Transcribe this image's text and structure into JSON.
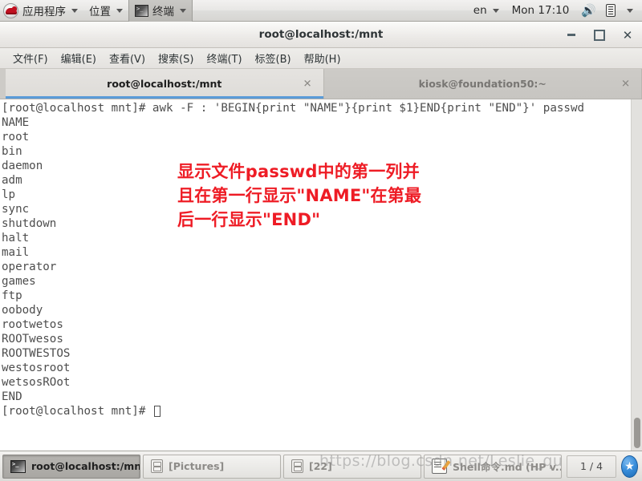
{
  "top_panel": {
    "logo_icon": "redhat-logo-icon",
    "applications_label": "应用程序",
    "places_label": "位置",
    "terminal_label": "终端",
    "terminal_icon": "terminal-icon",
    "keyboard_layout": "en",
    "clock": "Mon 17:10",
    "volume_icon": "speaker-icon",
    "battery_icon": "document-battery-icon",
    "system_caret_icon": "chevron-down-icon"
  },
  "window": {
    "title": "root@localhost:/mnt",
    "minimize_icon": "minimize-icon",
    "maximize_icon": "maximize-icon",
    "close_icon": "close-icon"
  },
  "menubar": {
    "items": [
      {
        "label": "文件(F)"
      },
      {
        "label": "编辑(E)"
      },
      {
        "label": "查看(V)"
      },
      {
        "label": "搜索(S)"
      },
      {
        "label": "终端(T)"
      },
      {
        "label": "标签(B)"
      },
      {
        "label": "帮助(H)"
      }
    ]
  },
  "tabs": [
    {
      "label": "root@localhost:/mnt",
      "close_icon": "close-icon",
      "active": true
    },
    {
      "label": "kiosk@foundation50:~",
      "close_icon": "close-icon",
      "active": false
    }
  ],
  "terminal": {
    "command_line": "[root@localhost mnt]# awk -F : 'BEGIN{print \"NAME\"}{print $1}END{print \"END\"}' passwd",
    "output_lines": [
      "NAME",
      "root",
      "bin",
      "daemon",
      "adm",
      "lp",
      "sync",
      "shutdown",
      "halt",
      "mail",
      "operator",
      "games",
      "ftp",
      "oobody",
      "rootwetos",
      "ROOTwesos",
      "ROOTWESTOS",
      "westosroot",
      "wetsosROot",
      "END"
    ],
    "prompt": "[root@localhost mnt]# ",
    "cursor": "block-cursor",
    "background_color": "#ffffff",
    "text_color": "#4d4d4d",
    "scrollbar_icon": "scrollbar-thumb"
  },
  "annotation": {
    "color": "#ee1c25",
    "line1": "显示文件passwd中的第一列并",
    "line2": "且在第一行显示\"NAME\"在第最",
    "line3": "后一行显示\"END\""
  },
  "taskbar": {
    "items": [
      {
        "label": "root@localhost:/mnt",
        "icon": "terminal-icon",
        "active": true
      },
      {
        "label": "[Pictures]",
        "icon": "file-manager-icon",
        "active": false
      },
      {
        "label": "[22]",
        "icon": "file-manager-icon",
        "active": false
      },
      {
        "label": "Shell命令.md (HP v...",
        "icon": "notepad-edit-icon",
        "active": false
      }
    ],
    "workspace_indicator": "1 / 4",
    "trash_icon": "trash-icon"
  },
  "watermark": {
    "text": "https://blog.csdn.net/Leslie_qu"
  }
}
